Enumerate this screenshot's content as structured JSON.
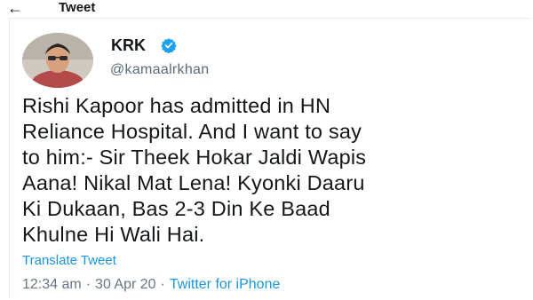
{
  "header": {
    "back_icon": "←",
    "title": "Tweet"
  },
  "tweet": {
    "display_name": "KRK",
    "verified_icon": "verified-badge-icon",
    "handle": "@kamaalrkhan",
    "text_lines": [
      "Rishi Kapoor has admitted in HN",
      "Reliance Hospital. And I want to say",
      "to him:- Sir Theek Hokar Jaldi Wapis",
      "Aana! Nikal Mat Lena! Kyonki Daaru",
      "Ki Dukaan, Bas 2-3 Din Ke Baad",
      "Khulne Hi Wali Hai."
    ],
    "translate_label": "Translate Tweet",
    "time": "12:34 am",
    "date": "30 Apr 20",
    "separator": "·",
    "source": "Twitter for iPhone"
  },
  "colors": {
    "link": "#1b95e0",
    "verified": "#1da1f2",
    "muted": "#657786",
    "text": "#14171a"
  }
}
